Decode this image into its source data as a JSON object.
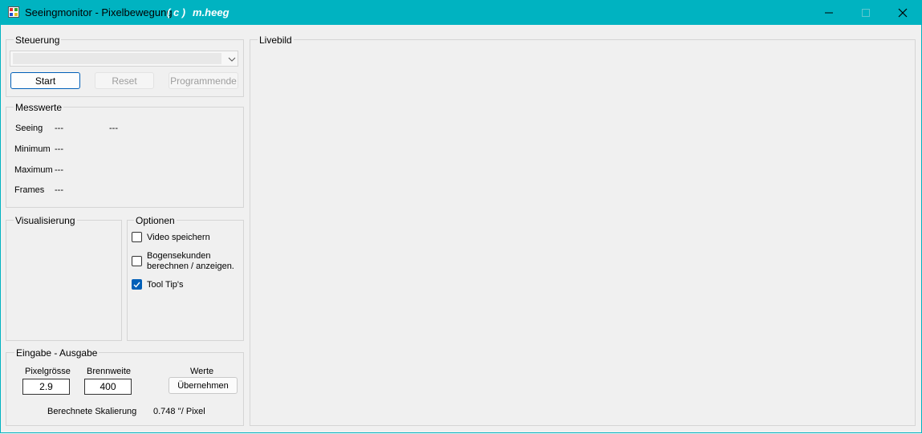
{
  "window": {
    "title": "Seeingmonitor - Pixelbewegung",
    "title_extra": "( c )",
    "title_author": "m.heeg",
    "accent_color": "#00b3c1"
  },
  "steuerung": {
    "group_label": "Steuerung",
    "combo_value": "",
    "start_label": "Start",
    "reset_label": "Reset",
    "end_label": "Programmende"
  },
  "messwerte": {
    "group_label": "Messwerte",
    "seeing_label": "Seeing",
    "seeing_value": "---",
    "seeing_value2": "---",
    "minimum_label": "Minimum",
    "minimum_value": "---",
    "maximum_label": "Maximum",
    "maximum_value": "---",
    "frames_label": "Frames",
    "frames_value": "---"
  },
  "visualisierung": {
    "group_label": "Visualisierung"
  },
  "optionen": {
    "group_label": "Optionen",
    "video_label": "Video speichern",
    "video_checked": false,
    "bogen_label_line1": "Bogensekunden",
    "bogen_label_line2": "berechnen / anzeigen.",
    "bogen_checked": false,
    "tooltip_label": "Tool Tip's",
    "tooltip_checked": true
  },
  "eingabe": {
    "group_label": "Eingabe - Ausgabe",
    "pixel_label": "Pixelgrösse",
    "pixel_value": "2.9",
    "brenn_label": "Brennweite",
    "brenn_value": "400",
    "werte_label": "Werte",
    "apply_label": "Übernehmen",
    "skal_label": "Berechnete Skalierung",
    "skal_value": "0.748 ''/ Pixel"
  },
  "livebild": {
    "group_label": "Livebild"
  }
}
